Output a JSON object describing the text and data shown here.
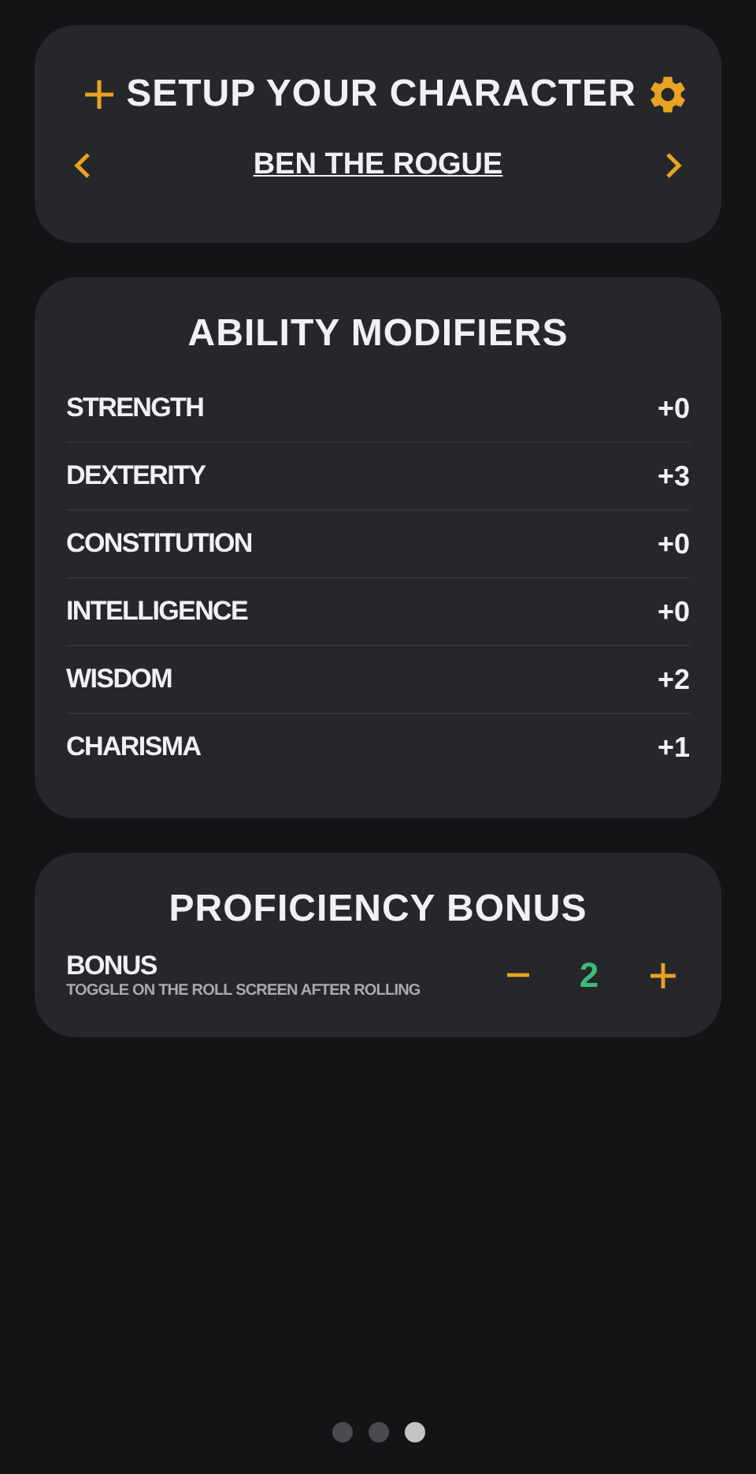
{
  "header": {
    "title": "SETUP YOUR CHARACTER",
    "character_name": "BEN THE ROGUE"
  },
  "abilities": {
    "title": "ABILITY MODIFIERS",
    "rows": [
      {
        "name": "STRENGTH",
        "value": "+0"
      },
      {
        "name": "DEXTERITY",
        "value": "+3"
      },
      {
        "name": "CONSTITUTION",
        "value": "+0"
      },
      {
        "name": "INTELLIGENCE",
        "value": "+0"
      },
      {
        "name": "WISDOM",
        "value": "+2"
      },
      {
        "name": "CHARISMA",
        "value": "+1"
      }
    ]
  },
  "proficiency": {
    "title": "PROFICIENCY BONUS",
    "label": "BONUS",
    "hint": "TOGGLE ON THE ROLL SCREEN AFTER ROLLING",
    "value": "2"
  },
  "pages": [
    {
      "selected": false
    },
    {
      "selected": false
    },
    {
      "selected": true
    }
  ]
}
